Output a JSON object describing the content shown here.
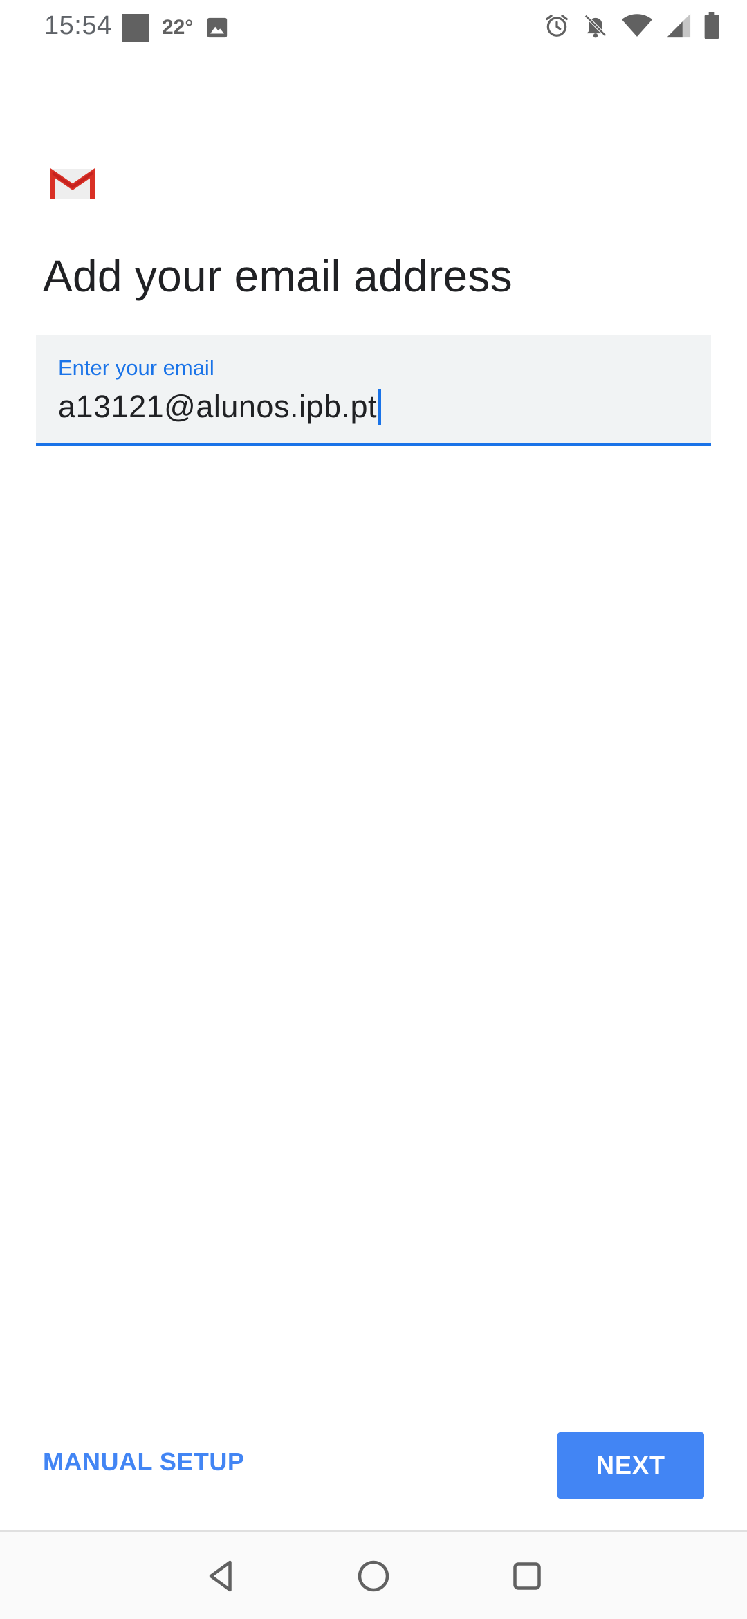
{
  "status_bar": {
    "time": "15:54",
    "temperature": "22°",
    "icons": [
      "square-notification-icon",
      "image-icon",
      "alarm-icon",
      "muted-bell-icon",
      "wifi-icon",
      "signal-icon",
      "battery-icon"
    ]
  },
  "app": {
    "logo": "gmail-logo-icon",
    "title": "Add your email address"
  },
  "email_field": {
    "label": "Enter your email",
    "value": "a13121@alunos.ipb.pt"
  },
  "actions": {
    "manual_setup_label": "MANUAL SETUP",
    "next_label": "NEXT"
  },
  "colors": {
    "accent": "#4285f4",
    "field_underline": "#1a73e8",
    "field_background": "#f1f3f4",
    "gmail_red": "#d93025"
  },
  "nav_bar": {
    "icons": [
      "back-icon",
      "home-icon",
      "recents-icon"
    ]
  }
}
